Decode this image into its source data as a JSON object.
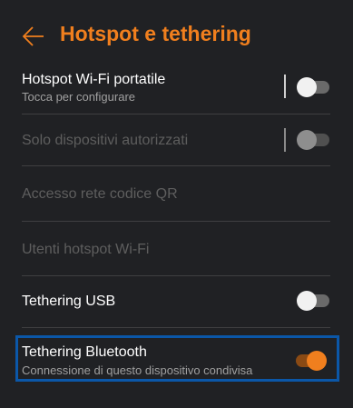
{
  "header": {
    "title": "Hotspot e tethering",
    "back_icon": "arrow-left-icon",
    "accent_color": "#f07f1e"
  },
  "settings": {
    "portable_hotspot": {
      "title": "Hotspot Wi-Fi portatile",
      "subtitle": "Tocca per configurare",
      "toggle": "off",
      "enabled": true
    },
    "authorized_only": {
      "title": "Solo dispositivi autorizzati",
      "toggle": "off",
      "enabled": false
    },
    "qr_access": {
      "title": "Accesso rete codice QR",
      "enabled": false
    },
    "hotspot_users": {
      "title": "Utenti hotspot Wi-Fi",
      "enabled": false
    },
    "usb_tethering": {
      "title": "Tethering USB",
      "toggle": "off",
      "enabled": true
    },
    "bluetooth_tethering": {
      "title": "Tethering Bluetooth",
      "subtitle": "Connessione di questo dispositivo condivisa",
      "toggle": "on",
      "enabled": true,
      "highlighted": true,
      "highlight_color": "#0b57a8"
    }
  }
}
